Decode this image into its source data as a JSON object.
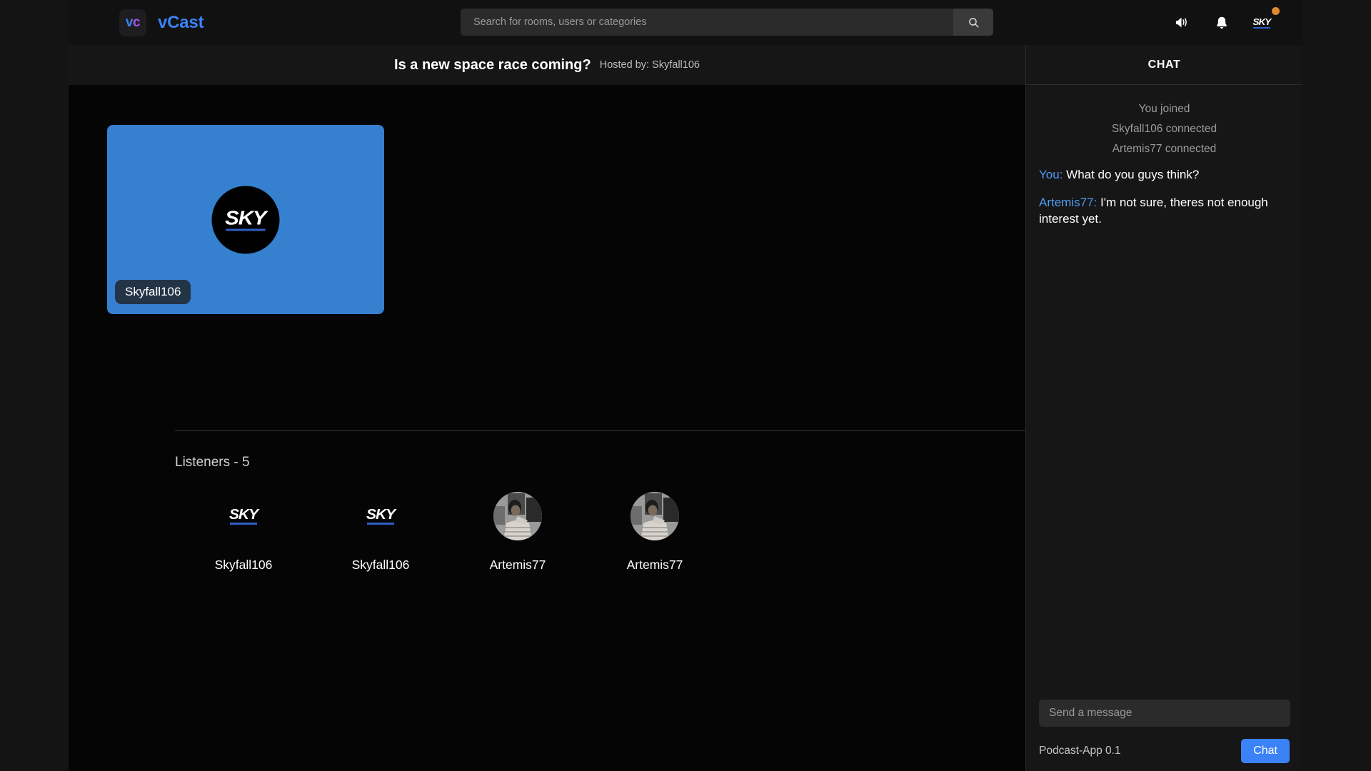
{
  "brand": {
    "badge_v": "v",
    "badge_c": "c",
    "name": "vCast",
    "accent_blue": "#3b82f6",
    "accent_purple": "#a855f7"
  },
  "search": {
    "placeholder": "Search for rooms, users or categories",
    "value": "",
    "button_icon": "search-icon"
  },
  "navbar": {
    "icons": [
      {
        "name": "megaphone-icon"
      },
      {
        "name": "bell-icon"
      },
      {
        "name": "user-avatar-sky"
      }
    ],
    "status_dot_color": "#e08a2e"
  },
  "room": {
    "title": "Is a new space race coming?",
    "host_label": "Hosted by: Skyfall106"
  },
  "speaker": {
    "name": "Skyfall106",
    "tile_color": "#3680d0",
    "avatar_logo": "SKY"
  },
  "listeners": {
    "heading": "Listeners - 5",
    "count": 5,
    "items": [
      {
        "name": "Skyfall106",
        "avatar_type": "sky-logo"
      },
      {
        "name": "Skyfall106",
        "avatar_type": "sky-logo"
      },
      {
        "name": "Artemis77",
        "avatar_type": "photo"
      },
      {
        "name": "Artemis77",
        "avatar_type": "photo"
      }
    ]
  },
  "chat": {
    "header": "CHAT",
    "system_messages": [
      "You joined",
      "Skyfall106 connected",
      "Artemis77 connected"
    ],
    "messages": [
      {
        "author": "You:",
        "text": "What do you guys think?"
      },
      {
        "author": "Artemis77:",
        "text": "I'm not sure, theres not enough interest yet."
      }
    ],
    "input_placeholder": "Send a message",
    "input_value": "",
    "send_label": "Chat",
    "footer_version": "Podcast-App 0.1",
    "author_color": "#4f9cf0"
  }
}
